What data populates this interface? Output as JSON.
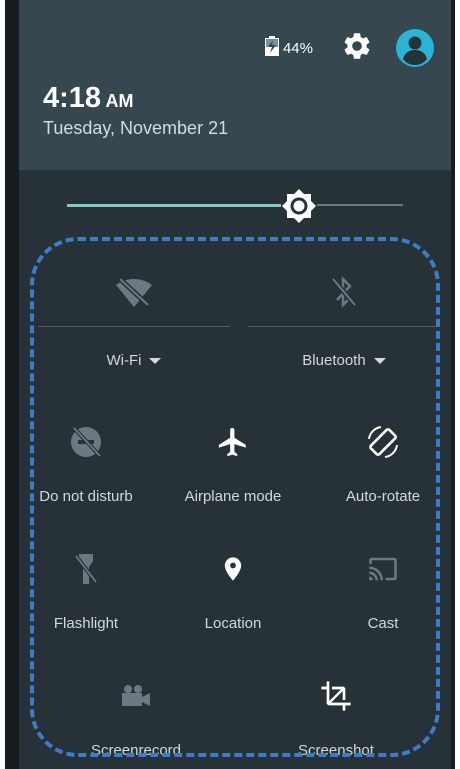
{
  "status": {
    "battery_percent": "44%",
    "icons": [
      "battery-charging-icon",
      "gear-icon",
      "account-circle-icon"
    ]
  },
  "clock": {
    "time": "4:18",
    "ampm": "AM",
    "date": "Tuesday, November 21"
  },
  "brightness": {
    "level": 0.69
  },
  "tiles": {
    "wifi": {
      "label": "Wi-Fi",
      "icon": "wifi-off-icon"
    },
    "bluetooth": {
      "label": "Bluetooth",
      "icon": "bluetooth-off-icon"
    },
    "dnd": {
      "label": "Do not disturb",
      "icon": "do-not-disturb-icon"
    },
    "airplane": {
      "label": "Airplane mode",
      "icon": "airplane-icon"
    },
    "autorotate": {
      "label": "Auto-rotate",
      "icon": "auto-rotate-icon"
    },
    "flashlight": {
      "label": "Flashlight",
      "icon": "flashlight-off-icon"
    },
    "location": {
      "label": "Location",
      "icon": "location-pin-icon"
    },
    "cast": {
      "label": "Cast",
      "icon": "cast-icon"
    },
    "screenrecord": {
      "label": "Screenrecord",
      "icon": "video-camera-icon"
    },
    "screenshot": {
      "label": "Screenshot",
      "icon": "crop-icon"
    }
  },
  "colors": {
    "panel": "#263238",
    "header": "#37474f",
    "accent": "#80cbc4",
    "active_icon": "#ffffff",
    "inactive_icon": "#6b7a82",
    "highlight_border": "#3a7dc9",
    "avatar": "#29b6d6"
  }
}
